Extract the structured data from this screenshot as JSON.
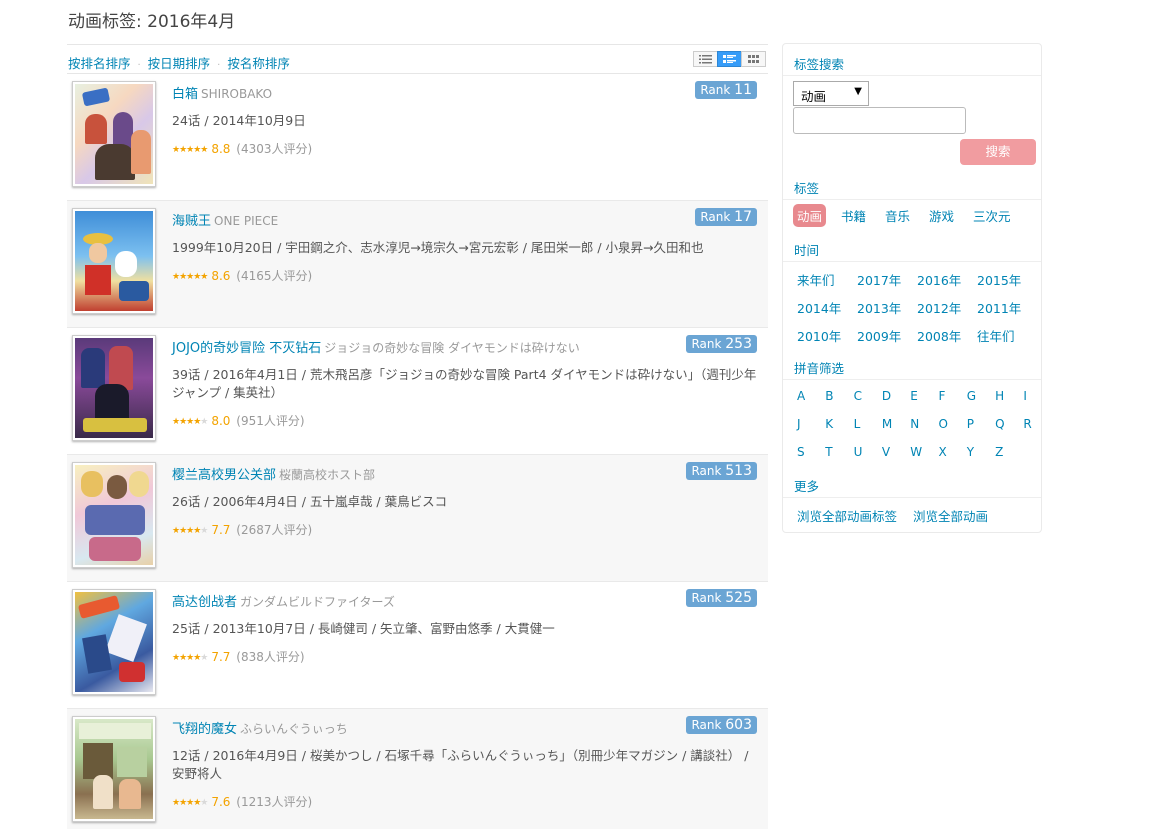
{
  "page_title": "动画标签: 2016年4月",
  "sort": {
    "by_rank": "按排名排序",
    "by_date": "按日期排序",
    "by_name": "按名称排序",
    "separator": "·"
  },
  "views": [
    "list-view-icon",
    "detail-view-icon",
    "grid-view-icon"
  ],
  "items": [
    {
      "title": "白箱",
      "original": "SHIROBAKO",
      "rank_label": "Rank",
      "rank": "11",
      "info": "24话 / 2014年10月9日",
      "stars": "★★★★★",
      "score": "8.8",
      "votes": "(4303人评分)"
    },
    {
      "title": "海贼王",
      "original": "ONE PIECE",
      "rank_label": "Rank",
      "rank": "17",
      "info": "1999年10月20日 / 宇田鋼之介、志水淳児→境宗久→宮元宏彰 / 尾田栄一郎 / 小泉昇→久田和也",
      "stars": "★★★★★",
      "score": "8.6",
      "votes": "(4165人评分)"
    },
    {
      "title": "JOJO的奇妙冒险 不灭钻石",
      "original": "ジョジョの奇妙な冒険 ダイヤモンドは砕けない",
      "rank_label": "Rank",
      "rank": "253",
      "info": "39话 / 2016年4月1日 / 荒木飛呂彦「ジョジョの奇妙な冒険 Part4 ダイヤモンドは砕けない」（週刊少年ジャンプ / 集英社）",
      "stars": "★★★★",
      "score": "8.0",
      "votes": "(951人评分)"
    },
    {
      "title": "樱兰高校男公关部",
      "original": "桜蘭高校ホスト部",
      "rank_label": "Rank",
      "rank": "513",
      "info": "26话 / 2006年4月4日 / 五十嵐卓哉 / 葉鳥ビスコ",
      "stars": "★★★★",
      "score": "7.7",
      "votes": "(2687人评分)"
    },
    {
      "title": "高达创战者",
      "original": "ガンダムビルドファイターズ",
      "rank_label": "Rank",
      "rank": "525",
      "info": "25话 / 2013年10月7日 / 長崎健司 / 矢立肇、富野由悠季 / 大貫健一",
      "stars": "★★★★",
      "score": "7.7",
      "votes": "(838人评分)"
    },
    {
      "title": "飞翔的魔女",
      "original": "ふらいんぐうぃっち",
      "rank_label": "Rank",
      "rank": "603",
      "info": "12话 / 2016年4月9日 / 桜美かつし / 石塚千尋「ふらいんぐうぃっち」（別冊少年マガジン / 講談社） / 安野将人",
      "stars": "★★★★",
      "score": "7.6",
      "votes": "(1213人评分)"
    }
  ],
  "sidebar": {
    "search_heading": "标签搜索",
    "select_value": "动画",
    "search_input_value": "",
    "search_button": "搜索",
    "tags_heading": "标签",
    "tags": [
      "动画",
      "书籍",
      "音乐",
      "游戏",
      "三次元"
    ],
    "time_heading": "时间",
    "years": [
      "来年们",
      "2017年",
      "2016年",
      "2015年",
      "2014年",
      "2013年",
      "2012年",
      "2011年",
      "2010年",
      "2009年",
      "2008年",
      "往年们"
    ],
    "pinyin_heading": "拼音筛选",
    "pinyin": [
      "A",
      "B",
      "C",
      "D",
      "E",
      "F",
      "G",
      "H",
      "I",
      "J",
      "K",
      "L",
      "M",
      "N",
      "O",
      "P",
      "Q",
      "R",
      "S",
      "T",
      "U",
      "V",
      "W",
      "X",
      "Y",
      "Z"
    ],
    "more_heading": "更多",
    "more_links": [
      "浏览全部动画标签",
      "浏览全部动画"
    ]
  },
  "colors": {
    "link": "#0084b4",
    "rank_badge": "#6ba5d4",
    "star": "#f3a300",
    "search_button": "#f19ca0",
    "active_tag": "#e8898e"
  }
}
